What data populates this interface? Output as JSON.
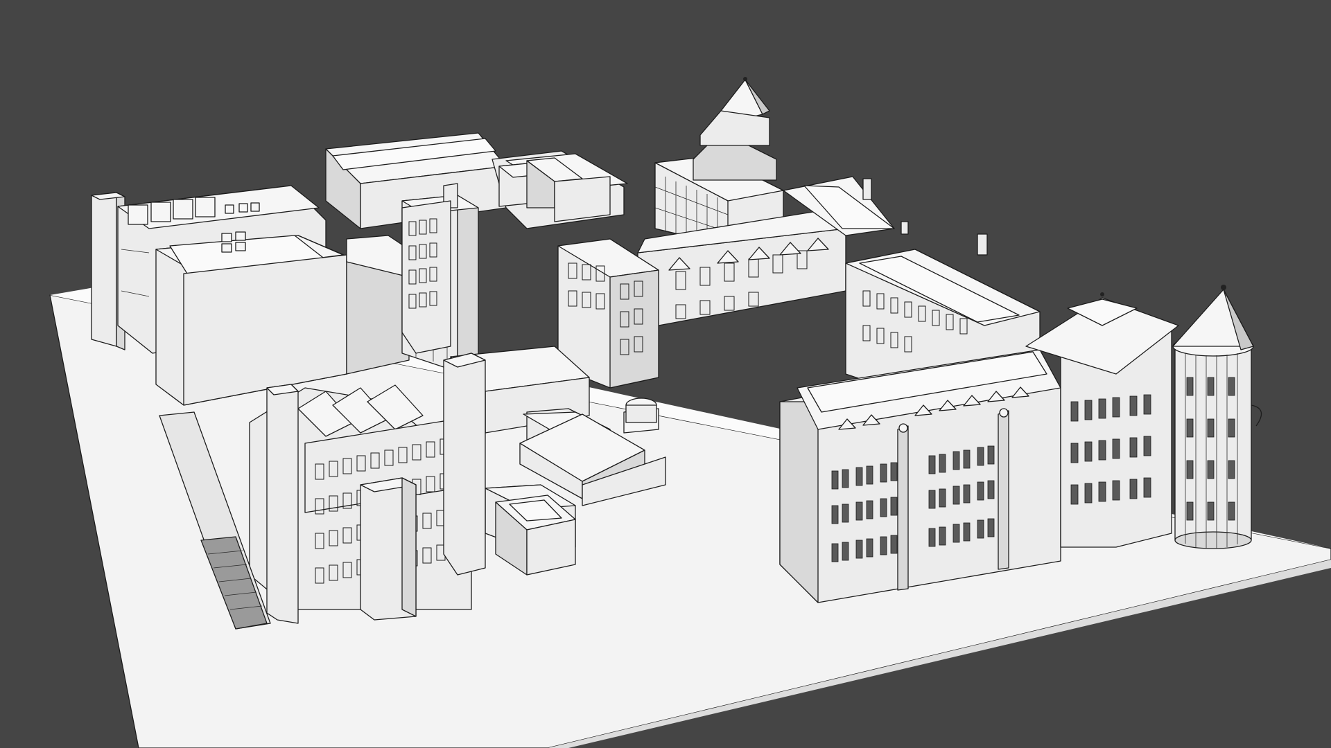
{
  "scene": {
    "background_color": "#454545",
    "base_plate_color": "#f2f2f2",
    "model_color": "#eeeeee",
    "line_color": "#1c1c1c",
    "render_style": "white clay render with black outlines"
  }
}
